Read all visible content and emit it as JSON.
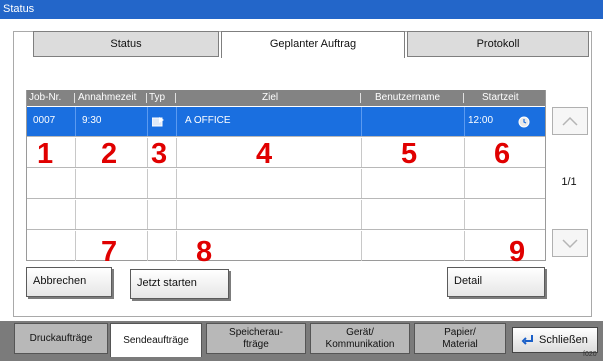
{
  "title": "Status",
  "tabs": [
    {
      "label": "Status"
    },
    {
      "label": "Geplanter Auftrag"
    },
    {
      "label": "Protokoll"
    }
  ],
  "columns": [
    "Job-Nr.",
    "Annahmezeit",
    "Typ",
    "Ziel",
    "Benutzername",
    "Startzeit"
  ],
  "rows": [
    {
      "job": "0007",
      "time": "9:30",
      "type_icon": "send-type-icon",
      "target": "A OFFICE",
      "user": "",
      "start": "12:00",
      "start_icon": "clock-icon"
    }
  ],
  "callouts": [
    "1",
    "2",
    "3",
    "4",
    "5",
    "6",
    "7",
    "8",
    "9"
  ],
  "pager": "1/1",
  "buttons": {
    "cancel": "Abbrechen",
    "start_now": "Jetzt starten",
    "detail": "Detail"
  },
  "footer_tabs": [
    {
      "label": "Druckaufträge"
    },
    {
      "label": "Sendeaufträge"
    },
    {
      "label": "Speicherau-\nfträge"
    },
    {
      "label": "Gerät/\nKommunikation"
    },
    {
      "label": "Papier/\nMaterial"
    }
  ],
  "close_label": "Schließen",
  "corner_text": "f020"
}
